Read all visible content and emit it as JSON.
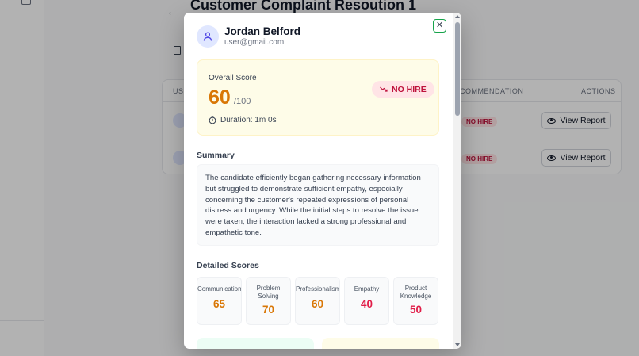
{
  "background": {
    "title": "Customer Complaint Resoution 1",
    "table_headers": {
      "col_user": "USI",
      "col_recommendation": "COMMENDATION",
      "col_actions": "ACTIONS"
    },
    "rows": [
      {
        "badge": "NO HIRE",
        "action": "View Report"
      },
      {
        "badge": "NO HIRE",
        "action": "View Report"
      }
    ]
  },
  "modal": {
    "user": {
      "name": "Jordan Belford",
      "email": "user@gmail.com"
    },
    "overall": {
      "label": "Overall Score",
      "value": "60",
      "max": "/100",
      "duration": "Duration: 1m 0s",
      "recommendation": "NO HIRE"
    },
    "summary": {
      "title": "Summary",
      "text": "The candidate efficiently began gathering necessary information but struggled to demonstrate sufficient empathy, especially concerning the customer's repeated expressions of personal distress and urgency. While the initial steps to resolve the issue were taken, the interaction lacked a strong professional and empathetic tone."
    },
    "detailed": {
      "title": "Detailed Scores",
      "items": [
        {
          "label": "Communication",
          "value": "65",
          "color": "#d97706"
        },
        {
          "label": "Problem Solving",
          "value": "70",
          "color": "#d97706"
        },
        {
          "label": "Professionalism",
          "value": "60",
          "color": "#d97706"
        },
        {
          "label": "Empathy",
          "value": "40",
          "color": "#e11d48"
        },
        {
          "label": "Product Knowledge",
          "value": "50",
          "color": "#e11d48"
        }
      ]
    }
  },
  "colors": {
    "accent_amber": "#d97706",
    "danger": "#be123c",
    "close_border": "#16a34a"
  }
}
